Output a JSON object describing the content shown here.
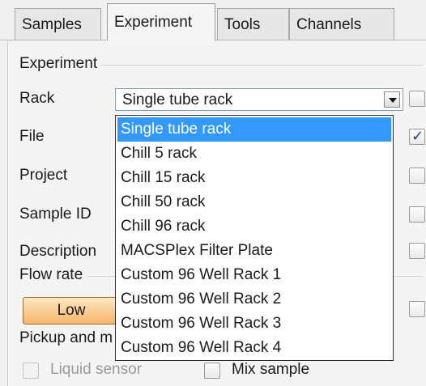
{
  "tabs": [
    {
      "label": "Samples",
      "active": false
    },
    {
      "label": "Experiment",
      "active": true
    },
    {
      "label": "Tools",
      "active": false
    },
    {
      "label": "Channels",
      "active": false
    }
  ],
  "experiment": {
    "group_title": "Experiment",
    "rack_label": "Rack",
    "rack_value": "Single tube rack",
    "file_label": "File",
    "project_label": "Project",
    "sample_id_label": "Sample ID",
    "description_label": "Description"
  },
  "flow_rate": {
    "group_title": "Flow rate",
    "low_label": "Low"
  },
  "pickup": {
    "group_title": "Pickup and m",
    "liquid_sensor_label": "Liquid sensor",
    "mix_sample_label": "Mix sample"
  },
  "rack_dropdown": {
    "options": [
      "Single tube rack",
      "Chill 5 rack",
      "Chill 15 rack",
      "Chill 50 rack",
      "Chill 96 rack",
      "MACSPlex Filter Plate",
      "Custom 96 Well Rack 1",
      "Custom 96 Well Rack 2",
      "Custom 96 Well Rack 3",
      "Custom 96 Well Rack 4"
    ],
    "selected": "Single tube rack"
  },
  "checkboxes": {
    "rack": false,
    "file": true,
    "project": false,
    "sample_id": false,
    "description": false,
    "flow_rate": false,
    "liquid_sensor": false,
    "mix_sample": false
  },
  "colors": {
    "selection": "#3399ff",
    "low_button": "#f6b56b"
  }
}
